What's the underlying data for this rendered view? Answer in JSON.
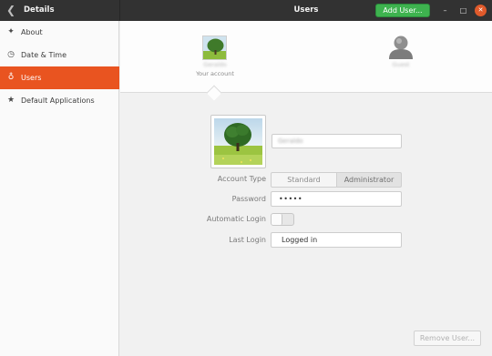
{
  "header": {
    "left_title": "Details",
    "center_title": "Users",
    "add_user_label": "Add User...",
    "back_icon": "chevron-left-icon",
    "minimize_glyph": "–",
    "maximize_glyph": "□",
    "close_glyph": "✕"
  },
  "sidebar": {
    "items": [
      {
        "label": "About",
        "icon": "sparkle-icon",
        "glyph": "✦",
        "active": false
      },
      {
        "label": "Date & Time",
        "icon": "clock-icon",
        "glyph": "◷",
        "active": false
      },
      {
        "label": "Users",
        "icon": "user-icon",
        "glyph": "♁",
        "active": true
      },
      {
        "label": "Default Applications",
        "icon": "star-icon",
        "glyph": "★",
        "active": false
      }
    ]
  },
  "accounts": {
    "current": {
      "name": "Geraldo",
      "subtitle": "Your account"
    },
    "other": {
      "name": "Guest"
    }
  },
  "details": {
    "full_name": "Geraldo",
    "account_type_label": "Account Type",
    "account_type_options": [
      "Standard",
      "Administrator"
    ],
    "account_type_selected": "Administrator",
    "password_label": "Password",
    "password_value": "•••••",
    "automatic_login_label": "Automatic Login",
    "automatic_login_on": false,
    "last_login_label": "Last Login",
    "last_login_value": "Logged in"
  },
  "footer": {
    "remove_user_label": "Remove User..."
  },
  "colors": {
    "accent": "#e95420",
    "add_button": "#3eb34f",
    "headerbar": "#323232"
  }
}
